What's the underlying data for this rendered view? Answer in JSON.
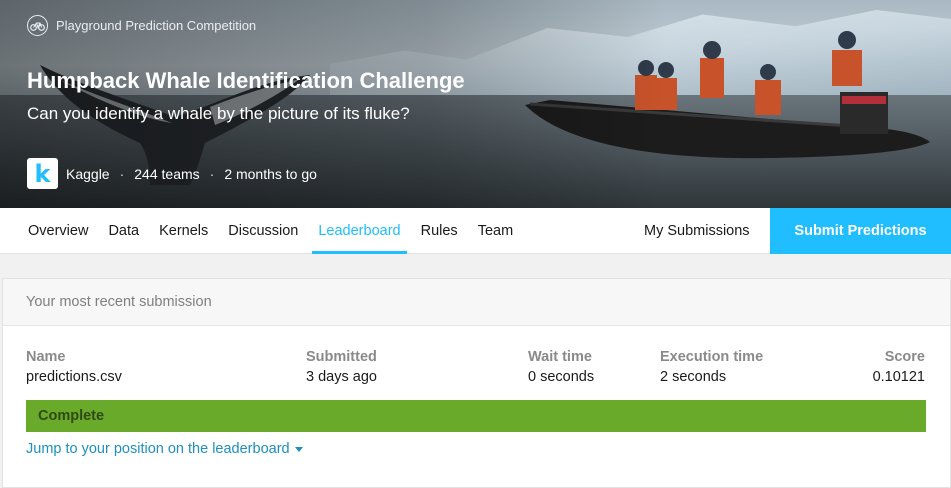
{
  "hero": {
    "competition_type": "Playground Prediction Competition",
    "competition_icon": "bicycle-icon",
    "title": "Humpback Whale Identification Challenge",
    "subtitle": "Can you identify a whale by the picture of its fluke?",
    "host": "Kaggle",
    "teams": "244 teams",
    "age": "2 months to go",
    "host_logo_letter": "k"
  },
  "nav": {
    "tabs": [
      {
        "label": "Overview"
      },
      {
        "label": "Data"
      },
      {
        "label": "Kernels"
      },
      {
        "label": "Discussion"
      },
      {
        "label": "Leaderboard",
        "active": true
      },
      {
        "label": "Rules"
      },
      {
        "label": "Team"
      }
    ],
    "my_submissions": "My Submissions",
    "submit": "Submit Predictions"
  },
  "submission": {
    "heading": "Your most recent submission",
    "name_label": "Name",
    "name": "predictions.csv",
    "submitted_label": "Submitted",
    "submitted": "3 days ago",
    "wait_label": "Wait time",
    "wait": "0 seconds",
    "exec_label": "Execution time",
    "exec": "2 seconds",
    "score_label": "Score",
    "score": "0.10121",
    "status": "Complete",
    "jump_link": "Jump to your position on the leaderboard"
  },
  "colors": {
    "accent": "#20beff",
    "complete": "#6aaa2a"
  }
}
